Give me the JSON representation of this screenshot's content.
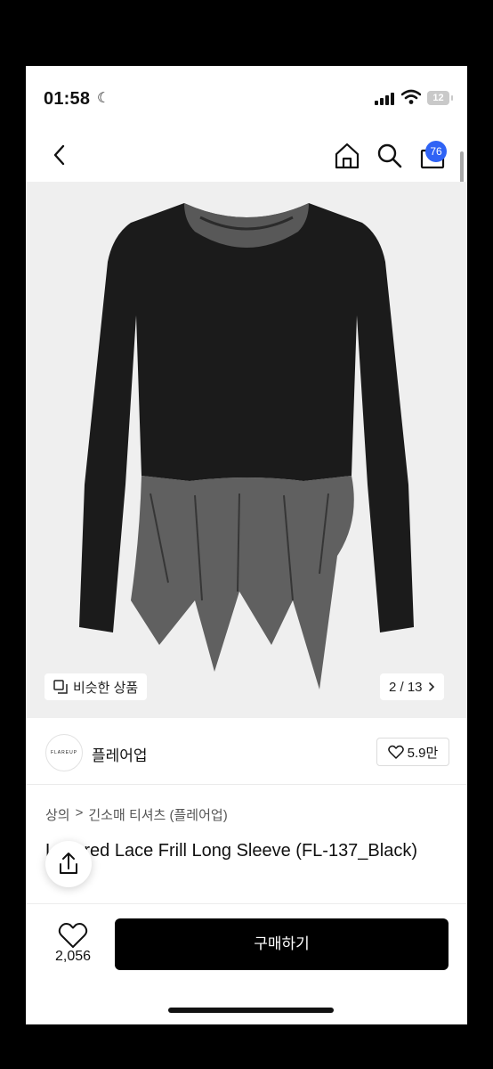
{
  "status": {
    "time": "01:58",
    "battery": "12"
  },
  "header": {
    "cart_count": "76"
  },
  "gallery": {
    "similar_label": "비슷한 상품",
    "page_indicator": "2 / 13"
  },
  "brand": {
    "logo_text": "FLAREUP",
    "name": "플레어업",
    "likes": "5.9만"
  },
  "breadcrumb": {
    "level1": "상의",
    "separator": ">",
    "level2": "긴소매 티셔츠 (플레어업)"
  },
  "product": {
    "title": "Layered Lace Frill Long Sleeve (FL-137_Black)"
  },
  "actions": {
    "like_count": "2,056",
    "buy_label": "구매하기"
  },
  "colors": {
    "accent": "#2f63f5",
    "buy_button": "#000000"
  }
}
